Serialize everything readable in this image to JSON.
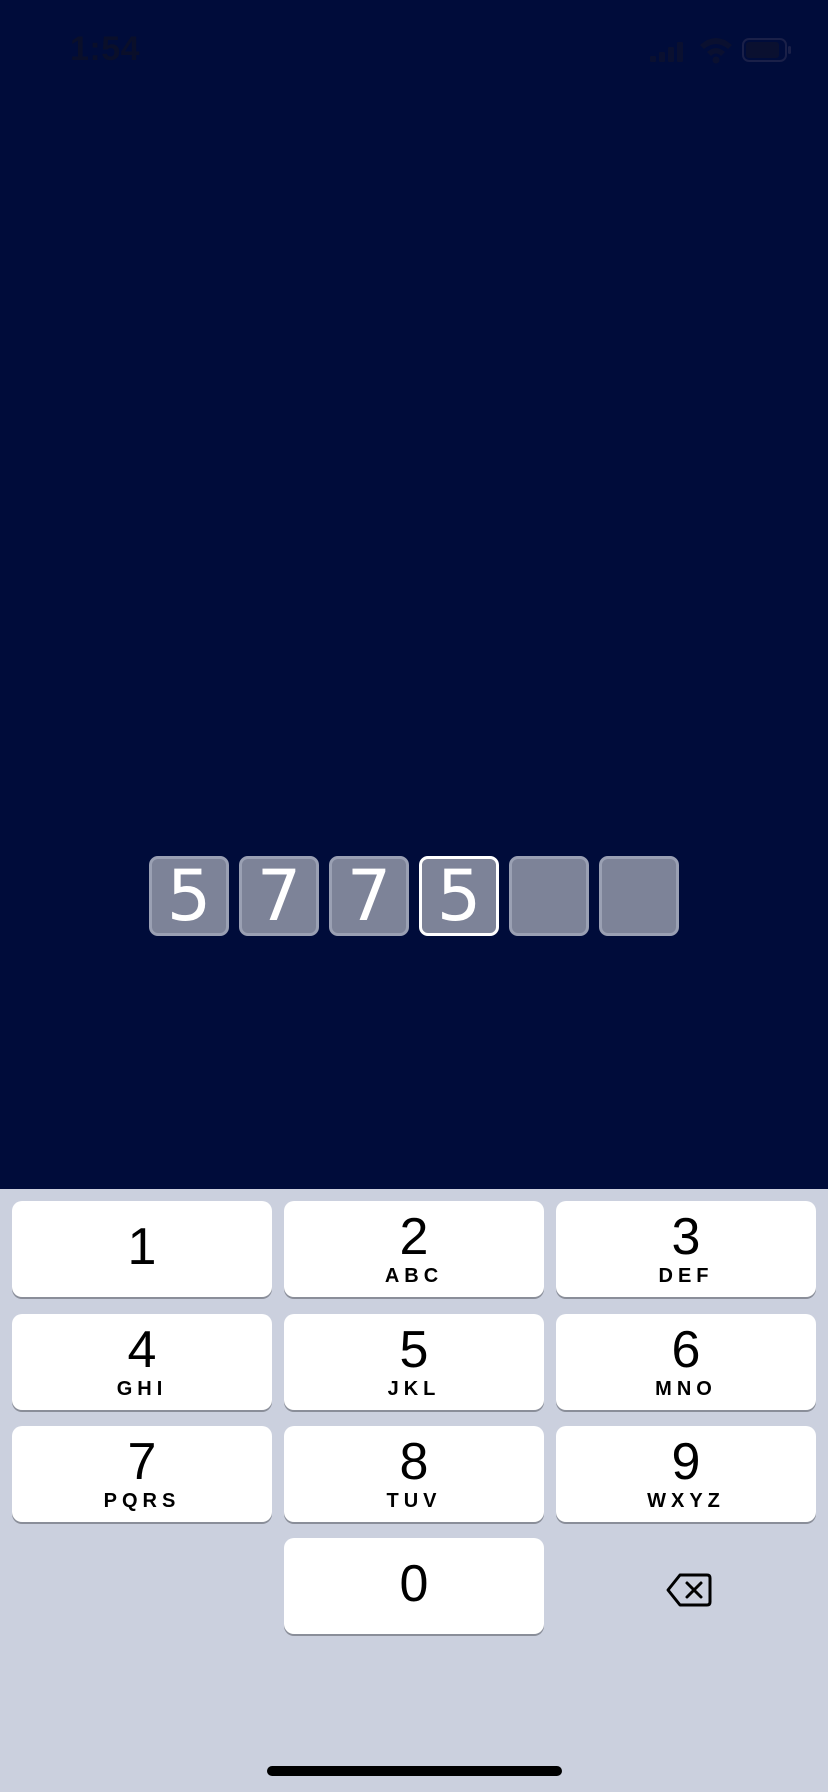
{
  "status_bar": {
    "time": "1:54",
    "icons": [
      "cellular-signal-icon",
      "wifi-icon",
      "battery-icon"
    ]
  },
  "code": {
    "digits": [
      "5",
      "7",
      "7",
      "5",
      "",
      ""
    ],
    "active_index": 3
  },
  "keypad": {
    "keys": [
      {
        "digit": "1",
        "letters": ""
      },
      {
        "digit": "2",
        "letters": "ABC"
      },
      {
        "digit": "3",
        "letters": "DEF"
      },
      {
        "digit": "4",
        "letters": "GHI"
      },
      {
        "digit": "5",
        "letters": "JKL"
      },
      {
        "digit": "6",
        "letters": "MNO"
      },
      {
        "digit": "7",
        "letters": "PQRS"
      },
      {
        "digit": "8",
        "letters": "TUV"
      },
      {
        "digit": "9",
        "letters": "WXYZ"
      },
      {
        "digit": "0",
        "letters": ""
      }
    ],
    "delete_icon": "backspace-icon"
  },
  "colors": {
    "background": "#000c3a",
    "code_box_fill": "#7d8398",
    "code_box_active_border": "#ffffff",
    "keyboard_background": "#cbd0de",
    "key_background": "#ffffff"
  }
}
